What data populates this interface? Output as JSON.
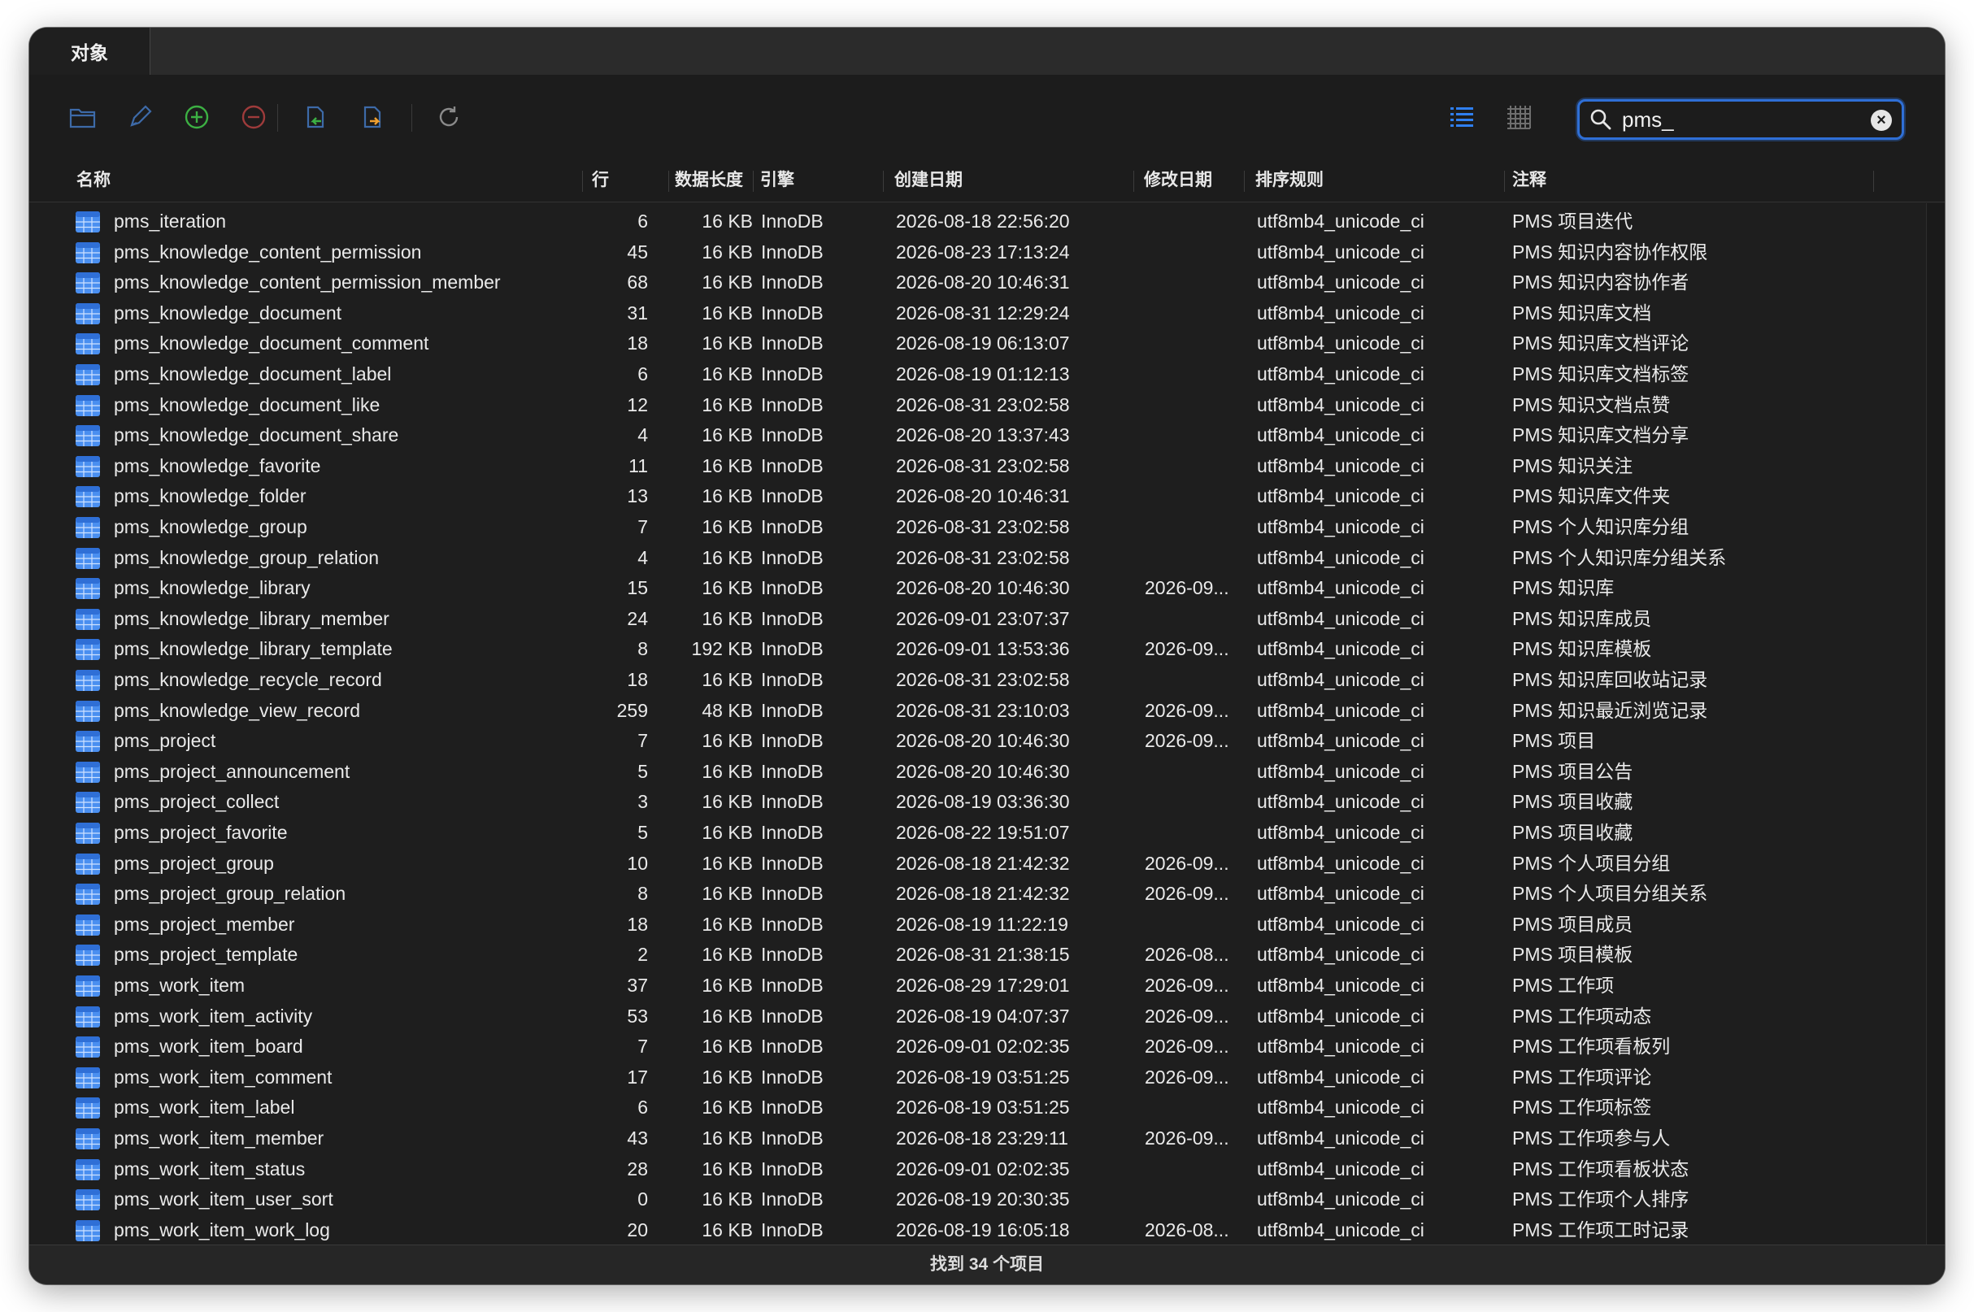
{
  "tabs": [
    {
      "label": "对象",
      "active": true
    }
  ],
  "toolbar": {
    "buttons": [
      {
        "name": "open-table-icon"
      },
      {
        "name": "design-table-icon"
      },
      {
        "name": "new-table-icon"
      },
      {
        "name": "delete-table-icon"
      },
      {
        "name": "import-wizard-icon"
      },
      {
        "name": "export-wizard-icon"
      },
      {
        "name": "refresh-icon"
      }
    ],
    "view_modes": [
      "list-view-icon",
      "grid-view-icon"
    ],
    "search": {
      "value": "pms_",
      "placeholder": ""
    }
  },
  "columns": {
    "name": "名称",
    "rows": "行",
    "data_length": "数据长度",
    "engine": "引擎",
    "created": "创建日期",
    "modified": "修改日期",
    "collation": "排序规则",
    "comment": "注释"
  },
  "rows": [
    {
      "name": "pms_iteration",
      "rows": "6",
      "size": "16 KB",
      "engine": "InnoDB",
      "created": "2026-08-18 22:56:20",
      "modified": "",
      "collation": "utf8mb4_unicode_ci",
      "comment": "PMS 项目迭代"
    },
    {
      "name": "pms_knowledge_content_permission",
      "rows": "45",
      "size": "16 KB",
      "engine": "InnoDB",
      "created": "2026-08-23 17:13:24",
      "modified": "",
      "collation": "utf8mb4_unicode_ci",
      "comment": "PMS 知识内容协作权限"
    },
    {
      "name": "pms_knowledge_content_permission_member",
      "rows": "68",
      "size": "16 KB",
      "engine": "InnoDB",
      "created": "2026-08-20 10:46:31",
      "modified": "",
      "collation": "utf8mb4_unicode_ci",
      "comment": "PMS 知识内容协作者"
    },
    {
      "name": "pms_knowledge_document",
      "rows": "31",
      "size": "16 KB",
      "engine": "InnoDB",
      "created": "2026-08-31 12:29:24",
      "modified": "",
      "collation": "utf8mb4_unicode_ci",
      "comment": "PMS 知识库文档"
    },
    {
      "name": "pms_knowledge_document_comment",
      "rows": "18",
      "size": "16 KB",
      "engine": "InnoDB",
      "created": "2026-08-19 06:13:07",
      "modified": "",
      "collation": "utf8mb4_unicode_ci",
      "comment": "PMS 知识库文档评论"
    },
    {
      "name": "pms_knowledge_document_label",
      "rows": "6",
      "size": "16 KB",
      "engine": "InnoDB",
      "created": "2026-08-19 01:12:13",
      "modified": "",
      "collation": "utf8mb4_unicode_ci",
      "comment": "PMS 知识库文档标签"
    },
    {
      "name": "pms_knowledge_document_like",
      "rows": "12",
      "size": "16 KB",
      "engine": "InnoDB",
      "created": "2026-08-31 23:02:58",
      "modified": "",
      "collation": "utf8mb4_unicode_ci",
      "comment": "PMS 知识文档点赞"
    },
    {
      "name": "pms_knowledge_document_share",
      "rows": "4",
      "size": "16 KB",
      "engine": "InnoDB",
      "created": "2026-08-20 13:37:43",
      "modified": "",
      "collation": "utf8mb4_unicode_ci",
      "comment": "PMS 知识库文档分享"
    },
    {
      "name": "pms_knowledge_favorite",
      "rows": "11",
      "size": "16 KB",
      "engine": "InnoDB",
      "created": "2026-08-31 23:02:58",
      "modified": "",
      "collation": "utf8mb4_unicode_ci",
      "comment": "PMS 知识关注"
    },
    {
      "name": "pms_knowledge_folder",
      "rows": "13",
      "size": "16 KB",
      "engine": "InnoDB",
      "created": "2026-08-20 10:46:31",
      "modified": "",
      "collation": "utf8mb4_unicode_ci",
      "comment": "PMS 知识库文件夹"
    },
    {
      "name": "pms_knowledge_group",
      "rows": "7",
      "size": "16 KB",
      "engine": "InnoDB",
      "created": "2026-08-31 23:02:58",
      "modified": "",
      "collation": "utf8mb4_unicode_ci",
      "comment": "PMS 个人知识库分组"
    },
    {
      "name": "pms_knowledge_group_relation",
      "rows": "4",
      "size": "16 KB",
      "engine": "InnoDB",
      "created": "2026-08-31 23:02:58",
      "modified": "",
      "collation": "utf8mb4_unicode_ci",
      "comment": "PMS 个人知识库分组关系"
    },
    {
      "name": "pms_knowledge_library",
      "rows": "15",
      "size": "16 KB",
      "engine": "InnoDB",
      "created": "2026-08-20 10:46:30",
      "modified": "2026-09...",
      "collation": "utf8mb4_unicode_ci",
      "comment": "PMS 知识库"
    },
    {
      "name": "pms_knowledge_library_member",
      "rows": "24",
      "size": "16 KB",
      "engine": "InnoDB",
      "created": "2026-09-01 23:07:37",
      "modified": "",
      "collation": "utf8mb4_unicode_ci",
      "comment": "PMS 知识库成员"
    },
    {
      "name": "pms_knowledge_library_template",
      "rows": "8",
      "size": "192 KB",
      "engine": "InnoDB",
      "created": "2026-09-01 13:53:36",
      "modified": "2026-09...",
      "collation": "utf8mb4_unicode_ci",
      "comment": "PMS 知识库模板"
    },
    {
      "name": "pms_knowledge_recycle_record",
      "rows": "18",
      "size": "16 KB",
      "engine": "InnoDB",
      "created": "2026-08-31 23:02:58",
      "modified": "",
      "collation": "utf8mb4_unicode_ci",
      "comment": "PMS 知识库回收站记录"
    },
    {
      "name": "pms_knowledge_view_record",
      "rows": "259",
      "size": "48 KB",
      "engine": "InnoDB",
      "created": "2026-08-31 23:10:03",
      "modified": "2026-09...",
      "collation": "utf8mb4_unicode_ci",
      "comment": "PMS 知识最近浏览记录"
    },
    {
      "name": "pms_project",
      "rows": "7",
      "size": "16 KB",
      "engine": "InnoDB",
      "created": "2026-08-20 10:46:30",
      "modified": "2026-09...",
      "collation": "utf8mb4_unicode_ci",
      "comment": "PMS 项目"
    },
    {
      "name": "pms_project_announcement",
      "rows": "5",
      "size": "16 KB",
      "engine": "InnoDB",
      "created": "2026-08-20 10:46:30",
      "modified": "",
      "collation": "utf8mb4_unicode_ci",
      "comment": "PMS 项目公告"
    },
    {
      "name": "pms_project_collect",
      "rows": "3",
      "size": "16 KB",
      "engine": "InnoDB",
      "created": "2026-08-19 03:36:30",
      "modified": "",
      "collation": "utf8mb4_unicode_ci",
      "comment": "PMS 项目收藏"
    },
    {
      "name": "pms_project_favorite",
      "rows": "5",
      "size": "16 KB",
      "engine": "InnoDB",
      "created": "2026-08-22 19:51:07",
      "modified": "",
      "collation": "utf8mb4_unicode_ci",
      "comment": "PMS 项目收藏"
    },
    {
      "name": "pms_project_group",
      "rows": "10",
      "size": "16 KB",
      "engine": "InnoDB",
      "created": "2026-08-18 21:42:32",
      "modified": "2026-09...",
      "collation": "utf8mb4_unicode_ci",
      "comment": "PMS 个人项目分组"
    },
    {
      "name": "pms_project_group_relation",
      "rows": "8",
      "size": "16 KB",
      "engine": "InnoDB",
      "created": "2026-08-18 21:42:32",
      "modified": "2026-09...",
      "collation": "utf8mb4_unicode_ci",
      "comment": "PMS 个人项目分组关系"
    },
    {
      "name": "pms_project_member",
      "rows": "18",
      "size": "16 KB",
      "engine": "InnoDB",
      "created": "2026-08-19 11:22:19",
      "modified": "",
      "collation": "utf8mb4_unicode_ci",
      "comment": "PMS 项目成员"
    },
    {
      "name": "pms_project_template",
      "rows": "2",
      "size": "16 KB",
      "engine": "InnoDB",
      "created": "2026-08-31 21:38:15",
      "modified": "2026-08...",
      "collation": "utf8mb4_unicode_ci",
      "comment": "PMS 项目模板"
    },
    {
      "name": "pms_work_item",
      "rows": "37",
      "size": "16 KB",
      "engine": "InnoDB",
      "created": "2026-08-29 17:29:01",
      "modified": "2026-09...",
      "collation": "utf8mb4_unicode_ci",
      "comment": "PMS 工作项"
    },
    {
      "name": "pms_work_item_activity",
      "rows": "53",
      "size": "16 KB",
      "engine": "InnoDB",
      "created": "2026-08-19 04:07:37",
      "modified": "2026-09...",
      "collation": "utf8mb4_unicode_ci",
      "comment": "PMS 工作项动态"
    },
    {
      "name": "pms_work_item_board",
      "rows": "7",
      "size": "16 KB",
      "engine": "InnoDB",
      "created": "2026-09-01 02:02:35",
      "modified": "2026-09...",
      "collation": "utf8mb4_unicode_ci",
      "comment": "PMS 工作项看板列"
    },
    {
      "name": "pms_work_item_comment",
      "rows": "17",
      "size": "16 KB",
      "engine": "InnoDB",
      "created": "2026-08-19 03:51:25",
      "modified": "2026-09...",
      "collation": "utf8mb4_unicode_ci",
      "comment": "PMS 工作项评论"
    },
    {
      "name": "pms_work_item_label",
      "rows": "6",
      "size": "16 KB",
      "engine": "InnoDB",
      "created": "2026-08-19 03:51:25",
      "modified": "",
      "collation": "utf8mb4_unicode_ci",
      "comment": "PMS 工作项标签"
    },
    {
      "name": "pms_work_item_member",
      "rows": "43",
      "size": "16 KB",
      "engine": "InnoDB",
      "created": "2026-08-18 23:29:11",
      "modified": "2026-09...",
      "collation": "utf8mb4_unicode_ci",
      "comment": "PMS 工作项参与人"
    },
    {
      "name": "pms_work_item_status",
      "rows": "28",
      "size": "16 KB",
      "engine": "InnoDB",
      "created": "2026-09-01 02:02:35",
      "modified": "",
      "collation": "utf8mb4_unicode_ci",
      "comment": "PMS 工作项看板状态"
    },
    {
      "name": "pms_work_item_user_sort",
      "rows": "0",
      "size": "16 KB",
      "engine": "InnoDB",
      "created": "2026-08-19 20:30:35",
      "modified": "",
      "collation": "utf8mb4_unicode_ci",
      "comment": "PMS 工作项个人排序"
    },
    {
      "name": "pms_work_item_work_log",
      "rows": "20",
      "size": "16 KB",
      "engine": "InnoDB",
      "created": "2026-08-19 16:05:18",
      "modified": "2026-08...",
      "collation": "utf8mb4_unicode_ci",
      "comment": "PMS 工作项工时记录"
    }
  ],
  "status": {
    "text": "找到 34 个项目"
  },
  "colors": {
    "accent": "#2f6fd6",
    "table_icon": "#4a8ff0",
    "add_green": "#3cb043",
    "remove_red": "#9e3b3b",
    "import_orange": "#f0a030"
  }
}
